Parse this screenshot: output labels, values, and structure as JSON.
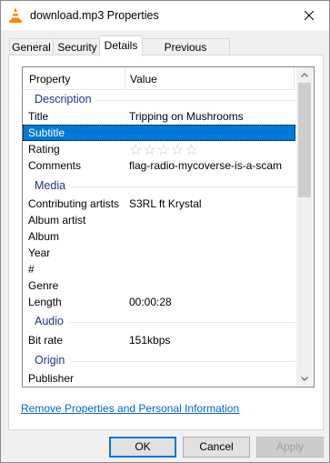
{
  "window": {
    "title": "download.mp3 Properties"
  },
  "tabs": [
    {
      "label": "General"
    },
    {
      "label": "Security"
    },
    {
      "label": "Details"
    },
    {
      "label": "Previous Versions"
    }
  ],
  "list": {
    "header": {
      "property": "Property",
      "value": "Value"
    },
    "groups": {
      "description": "Description",
      "media": "Media",
      "audio": "Audio",
      "origin": "Origin"
    },
    "rows": {
      "title": {
        "property": "Title",
        "value": "Tripping on Mushrooms"
      },
      "subtitle": {
        "property": "Subtitle",
        "value": ""
      },
      "rating": {
        "property": "Rating",
        "stars": "☆☆☆☆☆",
        "value": 0,
        "max": 5
      },
      "comments": {
        "property": "Comments",
        "value": "flag-radio-mycoverse-is-a-scam"
      },
      "contributing_artists": {
        "property": "Contributing artists",
        "value": "S3RL ft Krystal"
      },
      "album_artist": {
        "property": "Album artist",
        "value": ""
      },
      "album": {
        "property": "Album",
        "value": ""
      },
      "year": {
        "property": "Year",
        "value": ""
      },
      "track": {
        "property": "#",
        "value": ""
      },
      "genre": {
        "property": "Genre",
        "value": ""
      },
      "length": {
        "property": "Length",
        "value": "00:00:28"
      },
      "bit_rate": {
        "property": "Bit rate",
        "value": "151kbps"
      },
      "publisher": {
        "property": "Publisher",
        "value": ""
      }
    }
  },
  "links": {
    "remove_properties": "Remove Properties and Personal Information"
  },
  "buttons": {
    "ok": "OK",
    "cancel": "Cancel",
    "apply": "Apply"
  },
  "colors": {
    "selection": "#0078d7",
    "group_text": "#1e3287",
    "link": "#0066cc"
  }
}
